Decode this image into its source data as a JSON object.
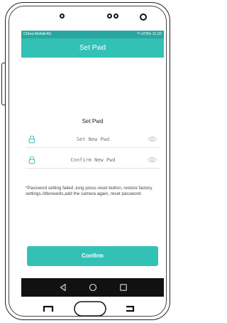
{
  "status_bar": {
    "carrier": "China Mobile4G",
    "indicators": "⁴ᴳ.ıl73% 11:22"
  },
  "title_bar": {
    "title": "Set Pwd"
  },
  "form": {
    "heading": "Set Pwd",
    "new_pwd": {
      "placeholder": "Set New Pwd",
      "value": ""
    },
    "confirm_pwd": {
      "placeholder": "Confirm New Pwd",
      "value": ""
    },
    "note": "*Password setting failed ,long press reset button, restore factory settings.Afterwards,add the camera again, reset password.",
    "confirm_label": "Confirm"
  },
  "icons": {
    "lock": "lock-icon",
    "eye": "eye-icon",
    "back": "back-triangle-icon",
    "home": "home-circle-icon",
    "recent": "recent-square-icon"
  },
  "colors": {
    "accent": "#33c1b6",
    "status_bar": "#2aa7a0",
    "nav_bar": "#111111"
  }
}
